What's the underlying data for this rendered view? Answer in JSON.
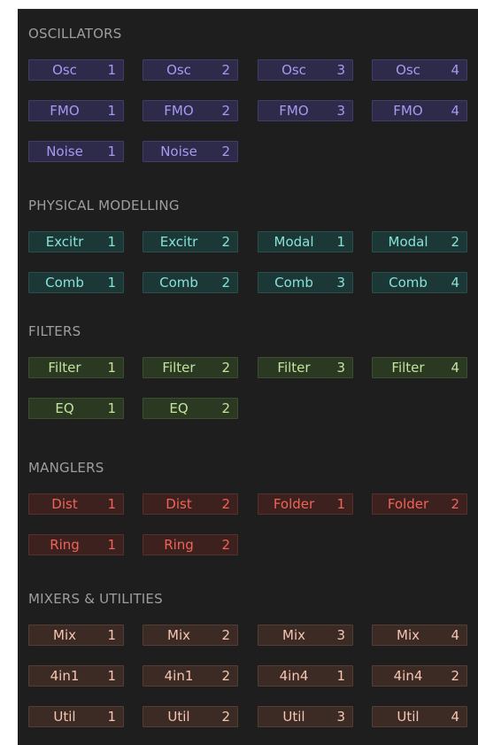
{
  "sections": [
    {
      "key": "osc",
      "title": "OSCILLATORS",
      "modules": [
        {
          "name": "Osc",
          "num": "1"
        },
        {
          "name": "Osc",
          "num": "2"
        },
        {
          "name": "Osc",
          "num": "3"
        },
        {
          "name": "Osc",
          "num": "4"
        },
        {
          "name": "FMO",
          "num": "1"
        },
        {
          "name": "FMO",
          "num": "2"
        },
        {
          "name": "FMO",
          "num": "3"
        },
        {
          "name": "FMO",
          "num": "4"
        },
        {
          "name": "Noise",
          "num": "1"
        },
        {
          "name": "Noise",
          "num": "2"
        }
      ]
    },
    {
      "key": "phys",
      "title": "PHYSICAL MODELLING",
      "modules": [
        {
          "name": "Excitr",
          "num": "1"
        },
        {
          "name": "Excitr",
          "num": "2"
        },
        {
          "name": "Modal",
          "num": "1"
        },
        {
          "name": "Modal",
          "num": "2"
        },
        {
          "name": "Comb",
          "num": "1"
        },
        {
          "name": "Comb",
          "num": "2"
        },
        {
          "name": "Comb",
          "num": "3"
        },
        {
          "name": "Comb",
          "num": "4"
        }
      ]
    },
    {
      "key": "filt",
      "title": "FILTERS",
      "modules": [
        {
          "name": "Filter",
          "num": "1"
        },
        {
          "name": "Filter",
          "num": "2"
        },
        {
          "name": "Filter",
          "num": "3"
        },
        {
          "name": "Filter",
          "num": "4"
        },
        {
          "name": "EQ",
          "num": "1"
        },
        {
          "name": "EQ",
          "num": "2"
        }
      ]
    },
    {
      "key": "mang",
      "title": "MANGLERS",
      "modules": [
        {
          "name": "Dist",
          "num": "1"
        },
        {
          "name": "Dist",
          "num": "2"
        },
        {
          "name": "Folder",
          "num": "1"
        },
        {
          "name": "Folder",
          "num": "2"
        },
        {
          "name": "Ring",
          "num": "1"
        },
        {
          "name": "Ring",
          "num": "2"
        }
      ]
    },
    {
      "key": "mix",
      "title": "MIXERS & UTILITIES",
      "modules": [
        {
          "name": "Mix",
          "num": "1"
        },
        {
          "name": "Mix",
          "num": "2"
        },
        {
          "name": "Mix",
          "num": "3"
        },
        {
          "name": "Mix",
          "num": "4"
        },
        {
          "name": "4in1",
          "num": "1"
        },
        {
          "name": "4in1",
          "num": "2"
        },
        {
          "name": "4in4",
          "num": "1"
        },
        {
          "name": "4in4",
          "num": "2"
        },
        {
          "name": "Util",
          "num": "1"
        },
        {
          "name": "Util",
          "num": "2"
        },
        {
          "name": "Util",
          "num": "3"
        },
        {
          "name": "Util",
          "num": "4"
        }
      ]
    }
  ]
}
